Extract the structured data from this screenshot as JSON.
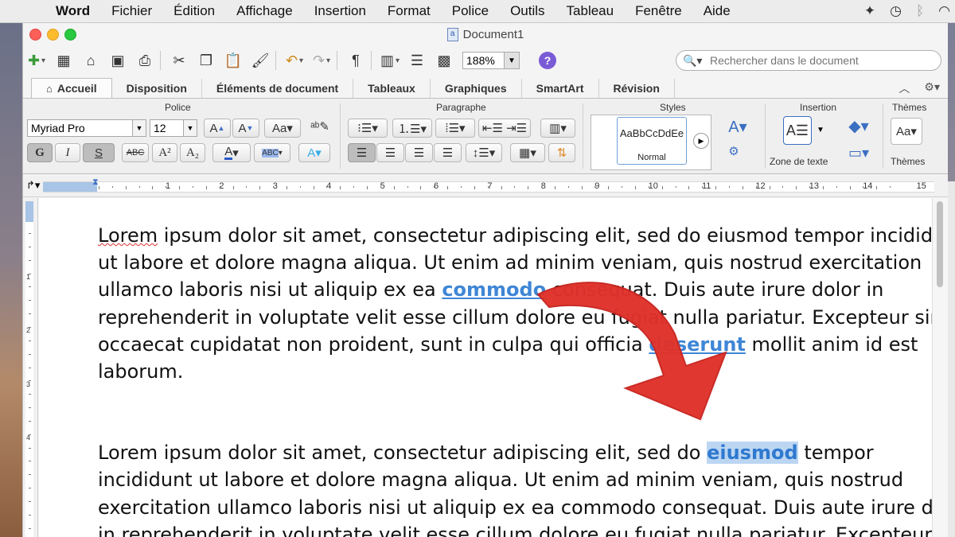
{
  "menubar": {
    "items": [
      "Word",
      "Fichier",
      "Édition",
      "Affichage",
      "Insertion",
      "Format",
      "Police",
      "Outils",
      "Tableau",
      "Fenêtre",
      "Aide"
    ]
  },
  "window": {
    "title": "Document1"
  },
  "toolbar": {
    "zoom": "188%",
    "search_placeholder": "Rechercher dans le document"
  },
  "ribbon": {
    "tabs": [
      "Accueil",
      "Disposition",
      "Éléments de document",
      "Tableaux",
      "Graphiques",
      "SmartArt",
      "Révision"
    ],
    "active_tab": "Accueil",
    "groups": {
      "police": "Police",
      "paragraphe": "Paragraphe",
      "styles": "Styles",
      "insertion": "Insertion",
      "themes": "Thèmes"
    },
    "font_name": "Myriad Pro",
    "font_size": "12",
    "style_sample": "AaBbCcDdEe",
    "style_name": "Normal",
    "textbox_label": "Zone de texte",
    "themes_label": "Thèmes",
    "buttons": {
      "bold": "G",
      "italic": "I",
      "underline": "S",
      "strike": "ABC",
      "superscript": "A²",
      "subscript": "A₂"
    }
  },
  "ruler": {
    "marks": [
      "1",
      "2",
      "3",
      "4",
      "5",
      "6",
      "7",
      "8",
      "9",
      "10",
      "11",
      "12",
      "13",
      "14",
      "15"
    ]
  },
  "vruler": {
    "marks": [
      "1",
      "2",
      "3",
      "4"
    ]
  },
  "document": {
    "para1": {
      "line1_a": "Lorem",
      "line1_b": " ipsum dolor sit amet, consectetur adipiscing elit, sed do eiusmod tempor incididu",
      "line2": "ut labore et dolore magna aliqua. Ut enim ad minim veniam, quis nostrud exercitation",
      "line3_a": "ullamco laboris nisi ut aliquip ex ea ",
      "line3_hl": "commodo",
      "line3_b": " consequat. Duis aute irure dolor in",
      "line4": "reprehenderit in voluptate velit esse cillum dolore eu fugiat nulla pariatur. Excepteur sint",
      "line5_a": "occaecat cupidatat non proident, sunt in culpa qui officia ",
      "line5_hl": "deserunt",
      "line5_b": " mollit anim id est",
      "line6": "laborum."
    },
    "para2": {
      "line1_a": "Lorem ipsum dolor sit amet, consectetur adipiscing elit, sed do ",
      "line1_sel": "eiusmod",
      "line1_b": " tempor",
      "line2": "incididunt ut labore et dolore magna aliqua. Ut enim ad minim veniam, quis nostrud",
      "line3": "exercitation ullamco laboris nisi ut aliquip ex ea commodo consequat. Duis aute irure dolor",
      "line4": "in reprehenderit in voluptate velit esse cillum dolore eu fugiat nulla pariatur. Excepteur s"
    }
  },
  "colors": {
    "highlight_text": "#3f86d6",
    "selection_bg": "#bcd6f2",
    "annotation_arrow": "#e0322b"
  }
}
